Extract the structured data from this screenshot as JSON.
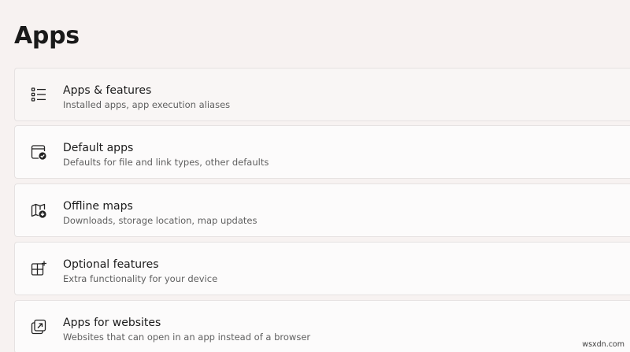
{
  "header": {
    "title": "Apps"
  },
  "items": [
    {
      "title": "Apps & features",
      "description": "Installed apps, app execution aliases",
      "icon": "app-list-icon"
    },
    {
      "title": "Default apps",
      "description": "Defaults for file and link types, other defaults",
      "icon": "default-apps-icon"
    },
    {
      "title": "Offline maps",
      "description": "Downloads, storage location, map updates",
      "icon": "offline-maps-icon"
    },
    {
      "title": "Optional features",
      "description": "Extra functionality for your device",
      "icon": "optional-features-icon"
    },
    {
      "title": "Apps for websites",
      "description": "Websites that can open in an app instead of a browser",
      "icon": "apps-for-websites-icon"
    }
  ],
  "watermark": "wsxdn.com"
}
